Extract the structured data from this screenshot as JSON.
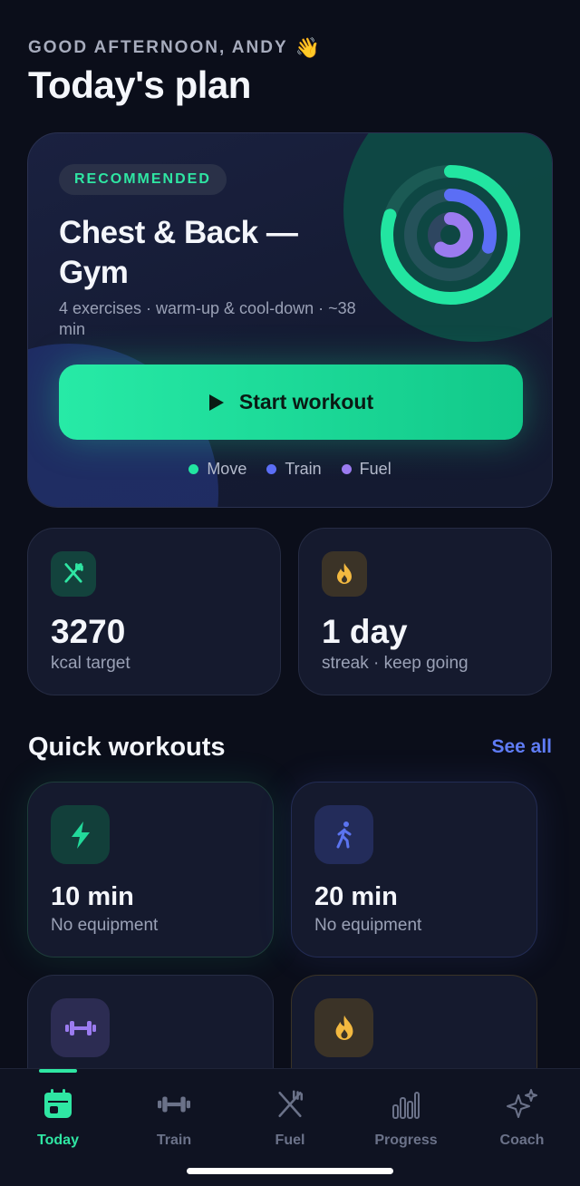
{
  "header": {
    "greeting": "GOOD AFTERNOON, ANDY",
    "greeting_emoji": "👋",
    "title": "Today's plan"
  },
  "hero": {
    "badge": "RECOMMENDED",
    "title": "Chest & Back — Gym",
    "subtitle": "4 exercises · warm-up & cool-down · ~38 min",
    "button_label": "Start workout",
    "rings": [
      {
        "name": "Move",
        "color": "#22e5a1",
        "progress": 0.8
      },
      {
        "name": "Train",
        "color": "#5b6ef5",
        "progress": 0.3
      },
      {
        "name": "Fuel",
        "color": "#9b7bf0",
        "progress": 0.6
      }
    ],
    "legend": [
      {
        "label": "Move",
        "color": "#22e5a1"
      },
      {
        "label": "Train",
        "color": "#5b6ef5"
      },
      {
        "label": "Fuel",
        "color": "#9b7bf0"
      }
    ]
  },
  "stats": [
    {
      "icon": "fork-knife-icon",
      "value": "3270",
      "label": "kcal target",
      "color": "#2fe6a3"
    },
    {
      "icon": "flame-icon",
      "value": "1 day",
      "label": "streak · keep going",
      "color": "#f3b940"
    }
  ],
  "quick_workouts": {
    "title": "Quick workouts",
    "see_all": "See all",
    "items": [
      {
        "icon": "lightning-icon",
        "value": "10 min",
        "label": "No equipment",
        "color": "#22d99a"
      },
      {
        "icon": "walking-person-icon",
        "value": "20 min",
        "label": "No equipment",
        "color": "#5b74f0"
      },
      {
        "icon": "dumbbell-icon",
        "color": "#9b7bf0"
      },
      {
        "icon": "flame-icon",
        "color": "#f3b940"
      }
    ]
  },
  "tabs": [
    {
      "label": "Today",
      "icon": "calendar-icon",
      "active": true
    },
    {
      "label": "Train",
      "icon": "dumbbell-icon",
      "active": false
    },
    {
      "label": "Fuel",
      "icon": "fork-knife-icon",
      "active": false
    },
    {
      "label": "Progress",
      "icon": "bar-chart-icon",
      "active": false
    },
    {
      "label": "Coach",
      "icon": "sparkles-icon",
      "active": false
    }
  ],
  "colors": {
    "background": "#0b0e1a",
    "accent": "#2fe6a3",
    "link": "#5f7cf5"
  }
}
